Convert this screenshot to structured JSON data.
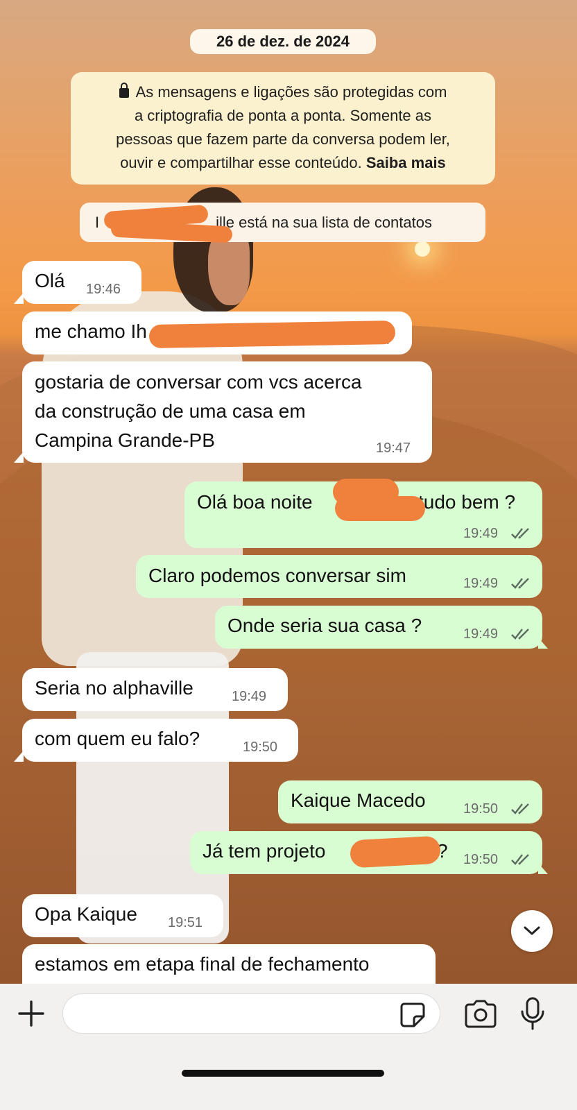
{
  "chat": {
    "date": "26 de dez. de 2024",
    "encryption_notice": {
      "line1": "As mensagens e ligações são protegidas com",
      "line2": "a criptografia de ponta a ponta. Somente as",
      "line3": "pessoas que fazem parte da conversa podem ler,",
      "line4": "ouvir e compartilhar esse conteúdo.",
      "link": "Saiba mais"
    },
    "contact_notice": {
      "name_prefix": "I",
      "text": "ille está na sua lista de contatos"
    },
    "messages": [
      {
        "direction": "in",
        "text": "Olá",
        "time": "19:46"
      },
      {
        "direction": "in",
        "text": "me chamo Ih",
        "time": "19:47"
      },
      {
        "direction": "in",
        "text": "gostaria de conversar com vcs acerca\nda construção de uma casa em\nCampina Grande-PB",
        "time": "19:47"
      },
      {
        "direction": "out",
        "text_before": "Olá boa noite",
        "text_after": "tudo bem ?",
        "time": "19:49",
        "status": "read"
      },
      {
        "direction": "out",
        "text": "Claro podemos conversar sim",
        "time": "19:49",
        "status": "read"
      },
      {
        "direction": "out",
        "text": "Onde seria sua casa ?",
        "time": "19:49",
        "status": "read"
      },
      {
        "direction": "in",
        "text": "Seria no alphaville",
        "time": "19:49"
      },
      {
        "direction": "in",
        "text": "com quem eu falo?",
        "time": "19:50"
      },
      {
        "direction": "out",
        "text": "Kaique Macedo",
        "time": "19:50",
        "status": "read"
      },
      {
        "direction": "out",
        "text_before": "Já tem projeto",
        "text_after": "?",
        "time": "19:50",
        "status": "read"
      },
      {
        "direction": "in",
        "text": "Opa Kaique",
        "time": "19:51"
      },
      {
        "direction": "in",
        "text": "estamos em etapa final de fechamento",
        "time": ""
      }
    ]
  },
  "composer": {
    "placeholder": "",
    "icons": [
      "plus-icon",
      "sticker-icon",
      "camera-icon",
      "microphone-icon"
    ]
  },
  "scroll_button_icon": "chevron-down-icon",
  "colors": {
    "incoming_bubble": "#ffffff",
    "outgoing_bubble": "#d9fdd3",
    "redaction": "#f0813c",
    "tick_read": "#5c6b60"
  }
}
